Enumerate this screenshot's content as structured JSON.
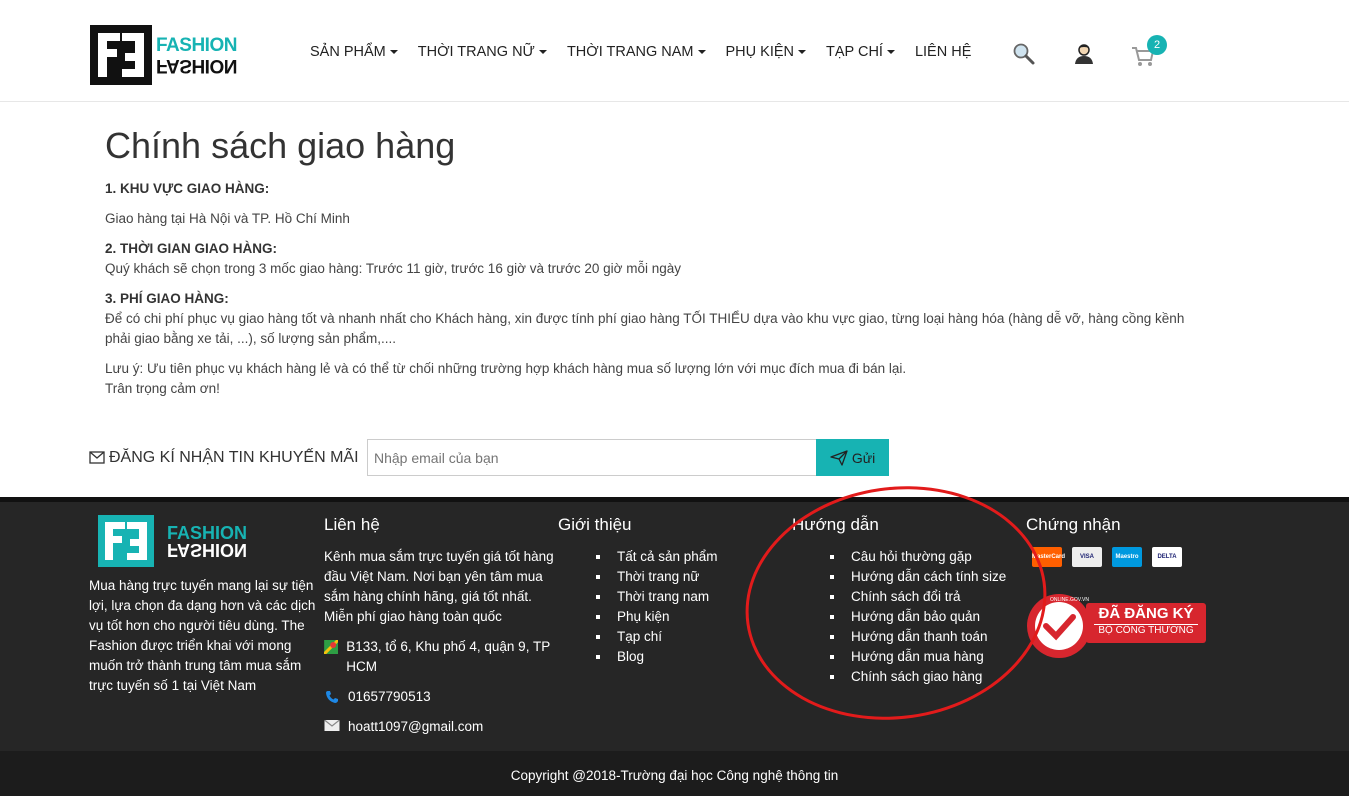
{
  "header": {
    "logo_top": "FASHION",
    "logo_bottom": "FASHION",
    "nav": [
      {
        "label": "SẢN PHẨM",
        "dropdown": true
      },
      {
        "label": "THỜI TRANG NỮ",
        "dropdown": true
      },
      {
        "label": "THỜI TRANG NAM",
        "dropdown": true
      },
      {
        "label": "PHỤ KIỆN",
        "dropdown": true
      },
      {
        "label": "TẠP CHÍ",
        "dropdown": true
      },
      {
        "label": "LIÊN HỆ",
        "dropdown": false
      }
    ],
    "cart_count": "2",
    "icons": [
      "search-icon",
      "user-icon",
      "cart-icon"
    ]
  },
  "content": {
    "title": "Chính sách giao hàng",
    "s1_heading": "1. KHU VỰC GIAO HÀNG:",
    "s1_text": "Giao hàng tại Hà Nội và TP. Hồ Chí Minh",
    "s2_heading": "2. THỜI GIAN GIAO HÀNG:",
    "s2_text": "Quý khách sẽ chọn trong 3 mốc giao hàng: Trước 11 giờ, trước 16 giờ và trước 20 giờ mỗi ngày",
    "s3_heading": "3. PHÍ GIAO HÀNG:",
    "s3_text_1": "Để có chi phí phục vụ giao hàng tốt và nhanh nhất cho Khách hàng, xin được tính phí giao hàng TỐI THIỂU dựa vào khu vực giao, từng loại hàng hóa (hàng dễ vỡ, hàng cồng kềnh",
    "s3_text_2": "phải giao bằng xe tải, ...), số lượng sản phẩm,....",
    "note_1": "Lưu ý: Ưu tiên phục vụ khách hàng lẻ và có thể từ chối những trường hợp khách hàng mua số lượng lớn với mục đích mua đi bán lại.",
    "note_2": "Trân trọng cảm ơn!"
  },
  "newsletter": {
    "label": "ĐĂNG KÍ NHẬN TIN KHUYẾN MÃI",
    "placeholder": "Nhập email của bạn",
    "button": "Gửi"
  },
  "footer": {
    "logo_top": "FASHION",
    "logo_bottom": "FASHION",
    "about": "Mua hàng trực tuyến mang lại sự tiện lợi, lựa chọn đa dạng hơn và các dịch vụ tốt hơn cho người tiêu dùng. The Fashion được triển khai với mong muốn trở thành trung tâm mua sắm trực tuyến số 1 tại Việt Nam",
    "contact": {
      "title": "Liên hệ",
      "desc": "Kênh mua sắm trực tuyến giá tốt hàng đầu Việt Nam. Nơi bạn yên tâm mua sắm hàng chính hãng, giá tốt nhất. Miễn phí giao hàng toàn quốc",
      "address": "B133, tổ 6, Khu phố 4, quận 9, TP HCM",
      "phone": "01657790513",
      "email": "hoatt1097@gmail.com"
    },
    "intro": {
      "title": "Giới thiệu",
      "items": [
        "Tất cả sản phẩm",
        "Thời trang nữ",
        "Thời trang nam",
        "Phụ kiện",
        "Tạp chí",
        "Blog"
      ]
    },
    "guide": {
      "title": "Hướng dẫn",
      "items": [
        "Câu hỏi thường gặp",
        "Hướng dẫn cách tính size",
        "Chính sách đổi trả",
        "Hướng dẫn bảo quản",
        "Hướng dẫn thanh toán",
        "Hướng dẫn mua hàng",
        "Chính sách giao hàng"
      ]
    },
    "cert": {
      "title": "Chứng nhận",
      "cards": [
        "MasterCard",
        "VISA",
        "Maestro",
        "DELTA"
      ],
      "badge_top": "ĐÃ ĐĂNG KÝ",
      "badge_bottom": "BỘ CÔNG THƯƠNG",
      "badge_ring": "ONLINE.GOV.VN"
    },
    "copyright": "Copyright @2018-Trường đại học Công nghệ thông tin"
  },
  "colors": {
    "accent": "#17b3b3",
    "footer_bg": "#262626",
    "annotation": "#e21b1b"
  }
}
